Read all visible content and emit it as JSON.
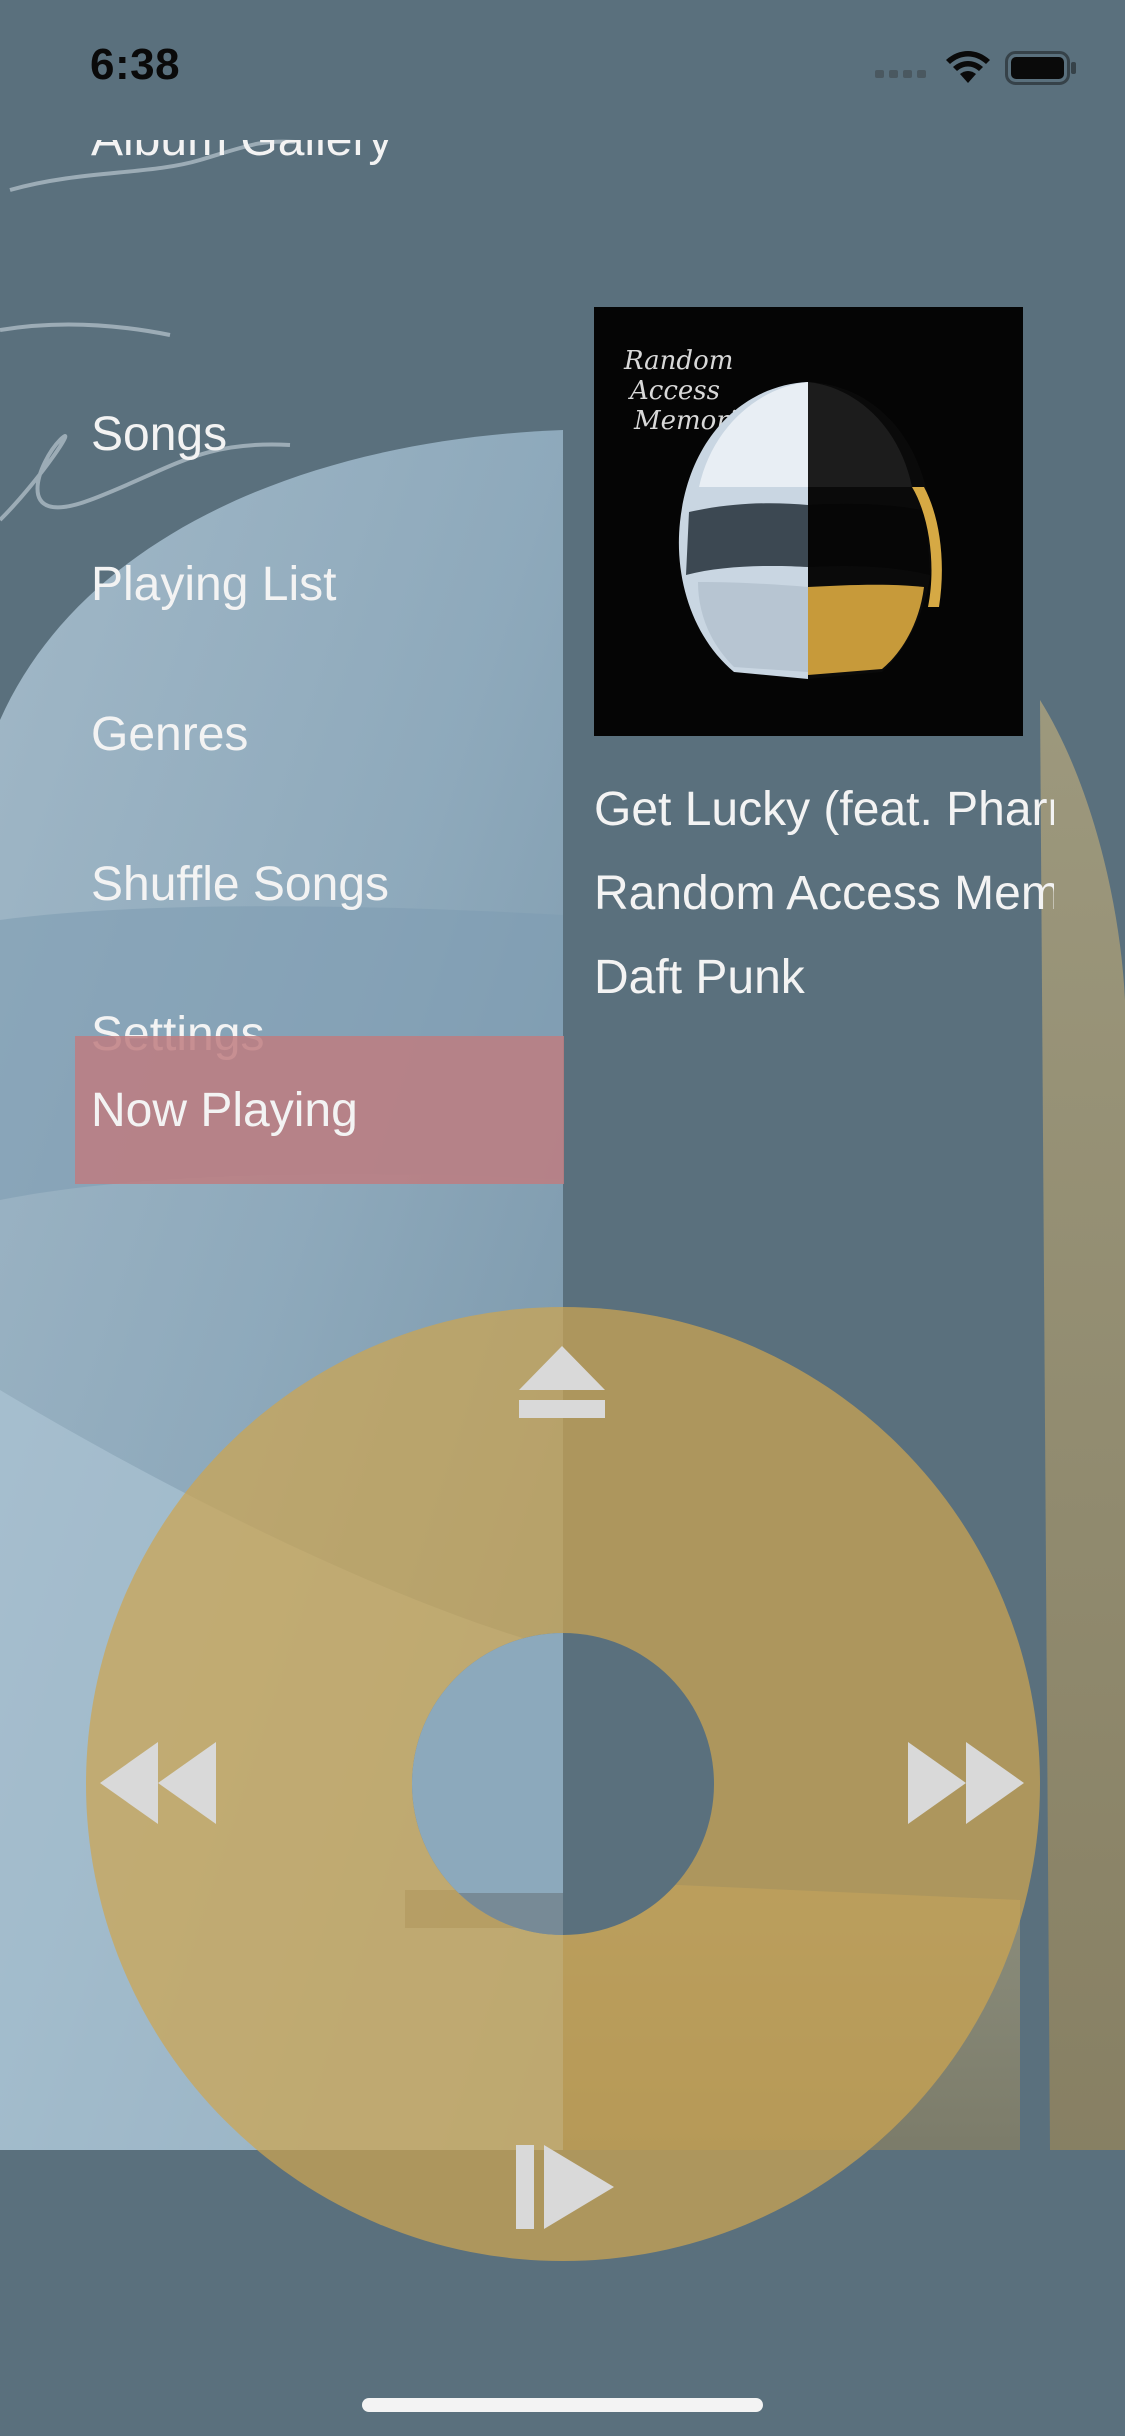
{
  "status_bar": {
    "time": "6:38"
  },
  "menu": {
    "items": [
      {
        "label": "Album Gallery"
      },
      {
        "label": "Songs"
      },
      {
        "label": "Playing List"
      },
      {
        "label": "Genres"
      },
      {
        "label": "Shuffle Songs"
      },
      {
        "label": "Settings"
      },
      {
        "label": "Now Playing",
        "selected": true
      }
    ]
  },
  "now_playing": {
    "song": "Get Lucky (feat. Pharrell Williams)",
    "album": "Random Access Memories",
    "artist": "Daft Punk",
    "album_art": {
      "script_text": "Random Access Memories"
    }
  },
  "wheel": {
    "top_icon": "eject-icon",
    "left_icon": "rewind-icon",
    "right_icon": "fast-forward-icon",
    "bottom_icon": "play-pause-icon"
  },
  "colors": {
    "background": "#5a707d",
    "wheel": "#cda550",
    "selected_row": "#be7d80",
    "text": "#f3f3f3"
  }
}
